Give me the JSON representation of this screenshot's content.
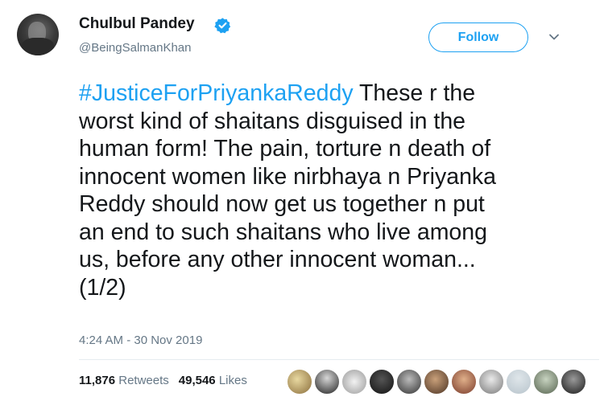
{
  "tweet": {
    "author": {
      "display_name": "Chulbul Pandey",
      "handle": "@BeingSalmanKhan",
      "verified": true,
      "avatar_icon": "profile-photo"
    },
    "follow_label": "Follow",
    "menu_icon": "chevron-down-icon",
    "text_lines": [
      {
        "hashtag": "#JusticeForPriyankaReddy",
        "text": " These r the"
      },
      {
        "hashtag": "",
        "text": "worst kind of shaitans disguised in the"
      },
      {
        "hashtag": "",
        "text": "human form! The pain, torture n death of"
      },
      {
        "hashtag": "",
        "text": "innocent women like nirbhaya n Priyanka"
      },
      {
        "hashtag": "",
        "text": "Reddy should now get us together n put"
      },
      {
        "hashtag": "",
        "text": "an end to such shaitans who live among"
      },
      {
        "hashtag": "",
        "text": "us, before any other innocent woman..."
      },
      {
        "hashtag": "",
        "text": "(1/2)"
      }
    ],
    "timestamp": "4:24 AM - 30 Nov 2019",
    "stats": {
      "retweets_count": "11,876",
      "retweets_label": "Retweets",
      "likes_count": "49,546",
      "likes_label": "Likes"
    }
  },
  "colors": {
    "accent": "#1da1f2",
    "text": "#14171a",
    "secondary": "#657786",
    "divider": "#e6ecf0"
  }
}
